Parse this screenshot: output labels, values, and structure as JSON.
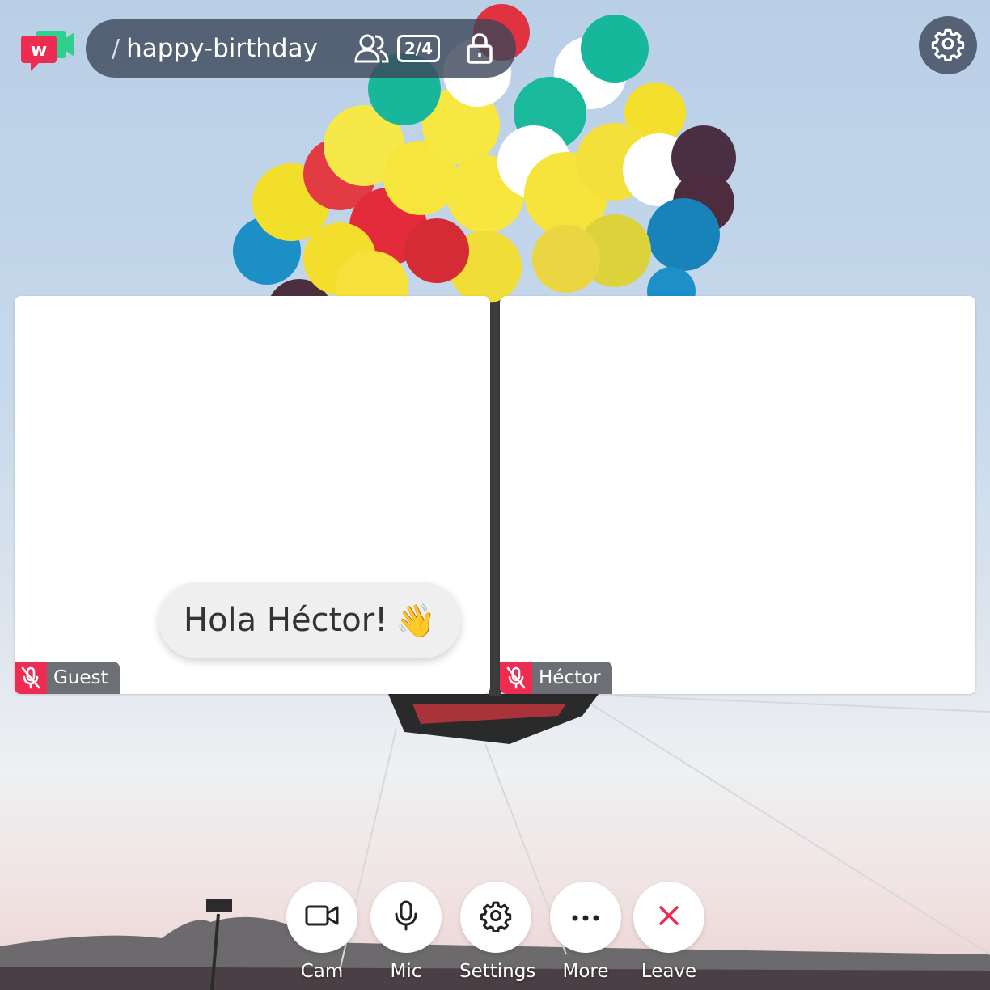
{
  "room": {
    "slash": "/",
    "name": "happy-birthday",
    "participant_count": "2/4"
  },
  "participants": [
    {
      "name": "Guest",
      "muted": true
    },
    {
      "name": "Héctor",
      "muted": true
    }
  ],
  "chat_bubble": {
    "text": "Hola Héctor!",
    "emoji": "👋"
  },
  "controls": {
    "cam": "Cam",
    "mic": "Mic",
    "settings": "Settings",
    "more": "More",
    "leave": "Leave"
  },
  "colors": {
    "accent_red": "#ee2c51",
    "logo_green": "#2fd08e",
    "pill_bg": "#3c465a"
  },
  "icons": [
    "whereby-logo-icon",
    "people-icon",
    "lock-icon",
    "gear-icon",
    "mic-off-icon",
    "camera-icon",
    "microphone-icon",
    "more-icon",
    "close-icon"
  ]
}
